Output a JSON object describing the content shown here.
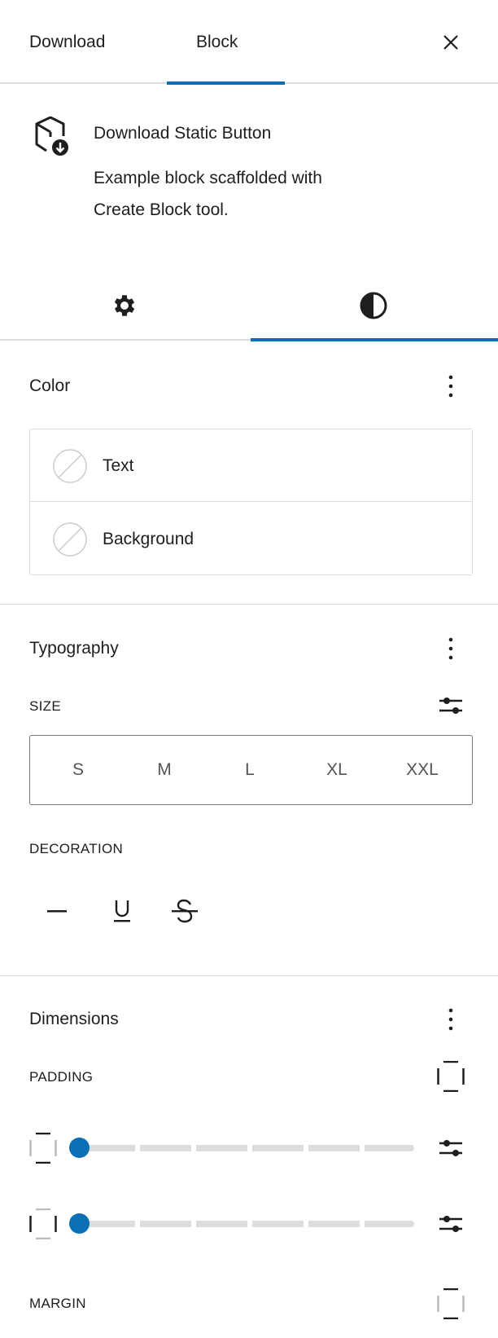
{
  "header": {
    "tabs": [
      {
        "label": "Download",
        "active": false
      },
      {
        "label": "Block",
        "active": true
      }
    ],
    "close_icon": "close-icon"
  },
  "block": {
    "icon": "box-download-icon",
    "title": "Download Static Button",
    "description_line1": "Example block scaffolded with",
    "description_line2": "Create Block tool."
  },
  "inspector_tabs": [
    {
      "icon": "gear-icon",
      "label": "Settings",
      "active": false
    },
    {
      "icon": "contrast-icon",
      "label": "Styles",
      "active": true
    }
  ],
  "color": {
    "title": "Color",
    "items": [
      {
        "label": "Text",
        "swatch": "none"
      },
      {
        "label": "Background",
        "swatch": "none"
      }
    ]
  },
  "typography": {
    "title": "Typography",
    "size_label": "SIZE",
    "sizes": [
      "S",
      "M",
      "L",
      "XL",
      "XXL"
    ],
    "decoration_label": "DECORATION",
    "decorations": [
      "none",
      "underline",
      "strikethrough"
    ]
  },
  "dimensions": {
    "title": "Dimensions",
    "padding_label": "PADDING",
    "padding_sliders": [
      {
        "side": "vertical",
        "value": 0
      },
      {
        "side": "horizontal",
        "value": 0
      }
    ],
    "margin_label": "MARGIN"
  },
  "colors": {
    "accent": "#0a6fb5",
    "border": "#dddddd",
    "text": "#1e1e1e"
  }
}
